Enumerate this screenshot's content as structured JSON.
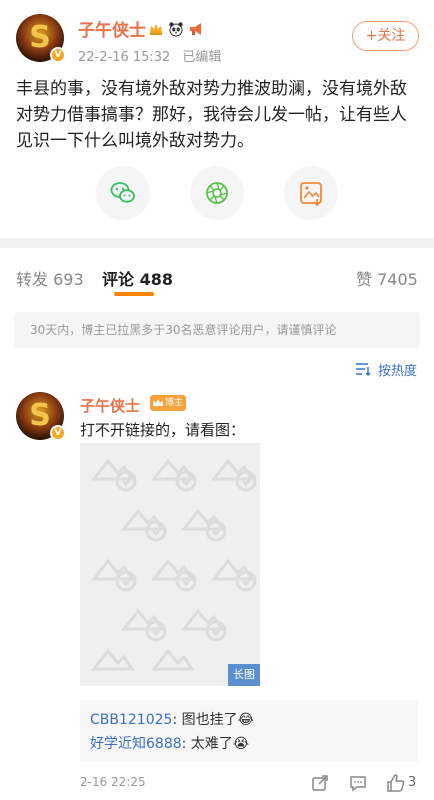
{
  "post": {
    "author": "子午侠士",
    "avatar_text": "S",
    "verified_badge": "V",
    "badge_icons": [
      "crown-icon",
      "panda-icon",
      "megaphone-icon"
    ],
    "date": "22-2-16 15:32",
    "edited_label": "已编辑",
    "follow_label": "+关注",
    "body": "丰县的事，没有境外敌对势力推波助澜，没有境外敌对势力借事搞事？那好，我待会儿发一帖，让有些人见识一下什么叫境外敌对势力。",
    "share_icons": [
      "wechat-icon",
      "moments-icon",
      "save-image-icon"
    ]
  },
  "tabs": [
    {
      "label": "转发",
      "count": "693"
    },
    {
      "label": "评论",
      "count": "488"
    },
    {
      "label": "赞",
      "count": "7405"
    }
  ],
  "notice": "30天内，博主已拉黑多于30名恶意评论用户，请谨慎评论",
  "sort_label": "按热度",
  "comment": {
    "author": "子午侠士",
    "blogger_tag": "博主",
    "text": "打不开链接的，请看图：",
    "long_image_tag": "长图",
    "replies": [
      {
        "user": "CBB121025",
        "text": ": 图也挂了😂"
      },
      {
        "user": "好学近知6888",
        "text": ": 太难了😭"
      }
    ],
    "time": "2-16 22:25",
    "like_count": "3"
  },
  "colors": {
    "accent": "#ff8200",
    "name": "#e8734a",
    "link": "#3b6fc4"
  }
}
